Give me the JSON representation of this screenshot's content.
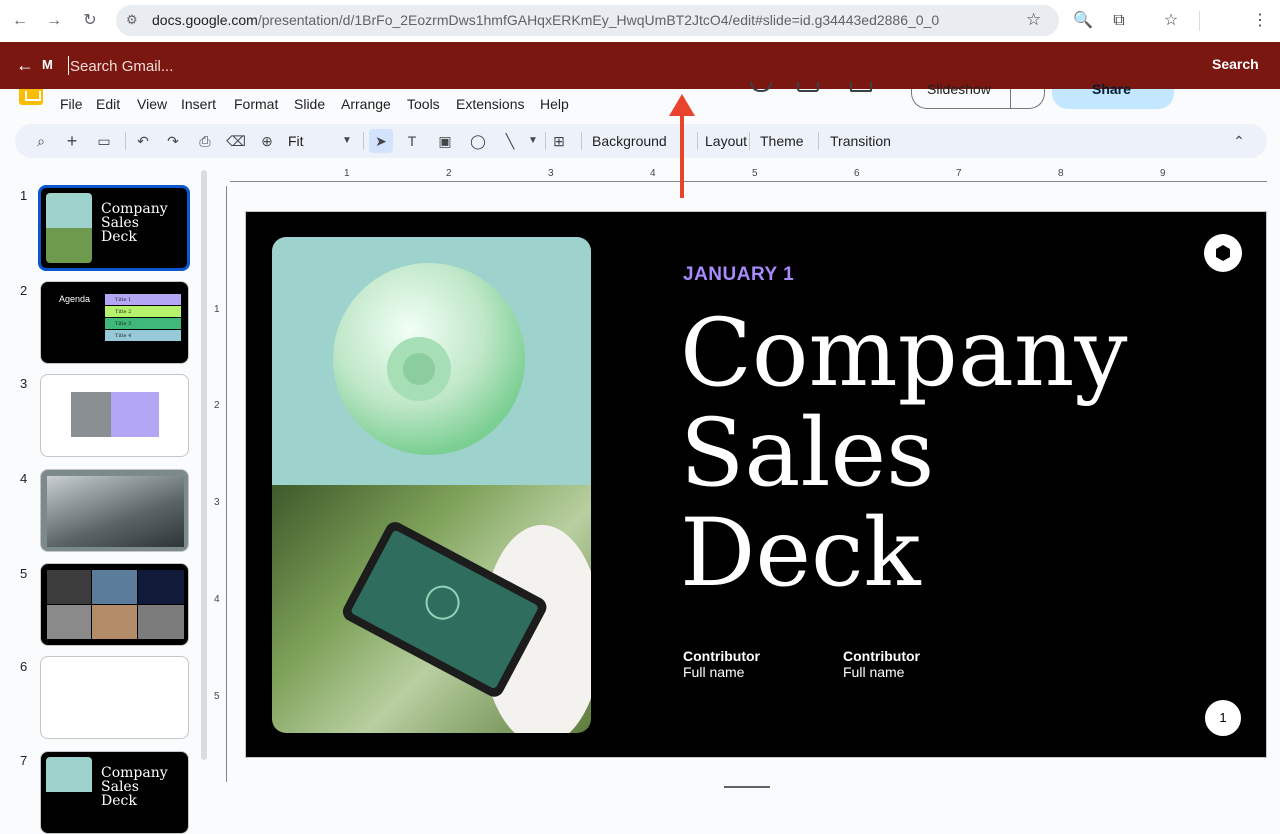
{
  "browser": {
    "url_host": "docs.google.com",
    "url_path": "/presentation/d/1BrFo_2EozrmDws1hmfGAHqxERKmEy_HwqUmBT2JtcO4/edit#slide=id.g34443ed2886_0_0"
  },
  "gmail_bar": {
    "logo": "M",
    "placeholder": "Search Gmail...",
    "search_label": "Search"
  },
  "menu": [
    "File",
    "Edit",
    "View",
    "Insert",
    "Format",
    "Slide",
    "Arrange",
    "Tools",
    "Extensions",
    "Help"
  ],
  "header": {
    "slideshow_label": "Slideshow",
    "share_label": "Share"
  },
  "toolbar": {
    "zoom_value": "Fit",
    "background_label": "Background",
    "layout_label": "Layout",
    "theme_label": "Theme",
    "transition_label": "Transition"
  },
  "ruler": {
    "top": [
      "1",
      "2",
      "3",
      "4",
      "5",
      "6",
      "7",
      "8",
      "9"
    ],
    "left": [
      "1",
      "2",
      "3",
      "4",
      "5"
    ]
  },
  "filmstrip": {
    "numbers": [
      "1",
      "2",
      "3",
      "4",
      "5",
      "6",
      "7"
    ],
    "thumb1_title": "Company Sales Deck",
    "thumb2_title": "Agenda",
    "thumb2_items": [
      "Title 1",
      "Title 2",
      "Title 3",
      "Title 4"
    ],
    "thumb7_title": "Company Sales Deck"
  },
  "slide": {
    "date": "JANUARY 1",
    "title_lines": [
      "Company",
      "Sales",
      "Deck"
    ],
    "contributors": [
      {
        "heading": "Contributor",
        "name": "Full name"
      },
      {
        "heading": "Contributor",
        "name": "Full name"
      }
    ],
    "page_number": "1"
  },
  "colors": {
    "gmail_bar": "#7a1710",
    "accent_date": "#a78bfa",
    "selected_thumb": "#0b57d0",
    "arrow": "#e8432c"
  }
}
